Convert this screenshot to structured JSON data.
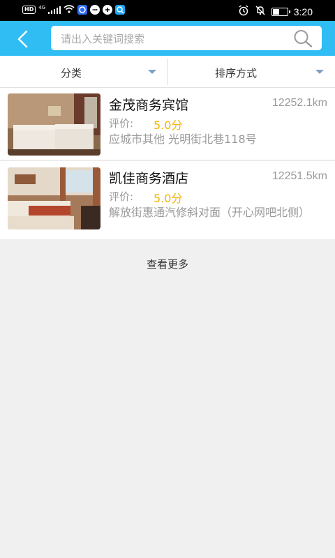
{
  "status_bar": {
    "left_icons": [
      "hd-icon",
      "signal-icon",
      "wifi-icon",
      "app-icon",
      "message-icon",
      "app-icon",
      "app-icon"
    ],
    "hd_text": "HD",
    "network_text": "4G",
    "time": "3:20",
    "right_icons": [
      "alarm-icon",
      "mute-icon",
      "battery-icon"
    ]
  },
  "header": {
    "search_placeholder": "请出入关键词搜索"
  },
  "filters": {
    "category_label": "分类",
    "sort_label": "排序方式"
  },
  "hotels": [
    {
      "name": "金茂商务宾馆",
      "distance": "12252.1km",
      "rating_label": "评价:",
      "rating": "5.0分",
      "address": "应城市其他 光明街北巷118号"
    },
    {
      "name": "凯佳商务酒店",
      "distance": "12251.5km",
      "rating_label": "评价:",
      "rating": "5.0分",
      "address": "解放街惠通汽修斜对面（开心网吧北侧）"
    }
  ],
  "footer": {
    "more_label": "查看更多"
  },
  "colors": {
    "accent": "#2fbdf4",
    "rating": "#f5b400",
    "muted_text": "#9a9a9a",
    "filter_arrow": "#7fa2c8"
  }
}
